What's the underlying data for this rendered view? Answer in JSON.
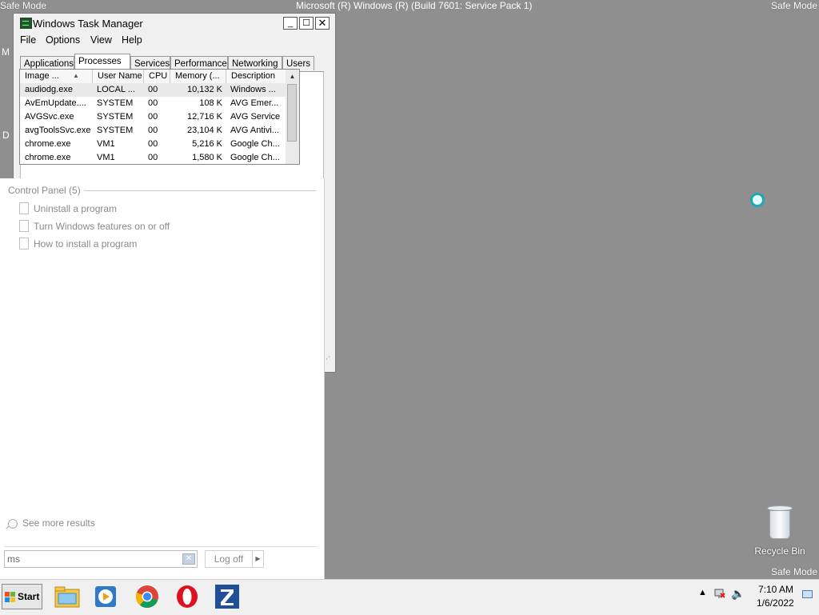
{
  "desktop": {
    "safe_mode_top_left": "Safe Mode",
    "safe_mode_top_right": "Safe Mode",
    "safe_mode_bottom_right": "Safe Mode",
    "build_text": "Microsoft (R) Windows (R) (Build 7601: Service Pack 1)",
    "left_fragment_1": "M",
    "left_fragment_2": "D",
    "recycle_bin_label": "Recycle Bin"
  },
  "task_manager": {
    "title": "Windows Task Manager",
    "controls": {
      "minimize": "_",
      "maximize": "☐",
      "close": "✕"
    },
    "menu": [
      "File",
      "Options",
      "View",
      "Help"
    ],
    "tabs": [
      "Applications",
      "Processes",
      "Services",
      "Performance",
      "Networking",
      "Users"
    ],
    "active_tab": "Processes",
    "columns": [
      "Image ...",
      "User Name",
      "CPU",
      "Memory (...",
      "Description"
    ],
    "rows": [
      [
        "audiodg.exe",
        "LOCAL ...",
        "00",
        "10,132 K",
        "Windows ..."
      ],
      [
        "AvEmUpdate....",
        "SYSTEM",
        "00",
        "108 K",
        "AVG Emer..."
      ],
      [
        "AVGSvc.exe",
        "SYSTEM",
        "00",
        "12,716 K",
        "AVG Service"
      ],
      [
        "avgToolsSvc.exe",
        "SYSTEM",
        "00",
        "23,104 K",
        "AVG Antivi..."
      ],
      [
        "chrome.exe",
        "VM1",
        "00",
        "5,216 K",
        "Google Ch..."
      ],
      [
        "chrome.exe",
        "VM1",
        "00",
        "1,580 K",
        "Google Ch..."
      ]
    ]
  },
  "start_menu": {
    "section_heading": "Control Panel (5)",
    "results": [
      "Uninstall a program",
      "Turn Windows features on or off",
      "How to install a program"
    ],
    "see_more": "See more results",
    "search_value": "ms",
    "logoff_label": "Log off",
    "logoff_arrow": "▶"
  },
  "taskbar": {
    "start_label": "Start",
    "pinned_apps": [
      "explorer-icon",
      "media-player-icon",
      "chrome-icon",
      "opera-icon",
      "zonealarm-icon"
    ],
    "clock_time": "7:10 AM",
    "clock_date": "1/6/2022"
  }
}
